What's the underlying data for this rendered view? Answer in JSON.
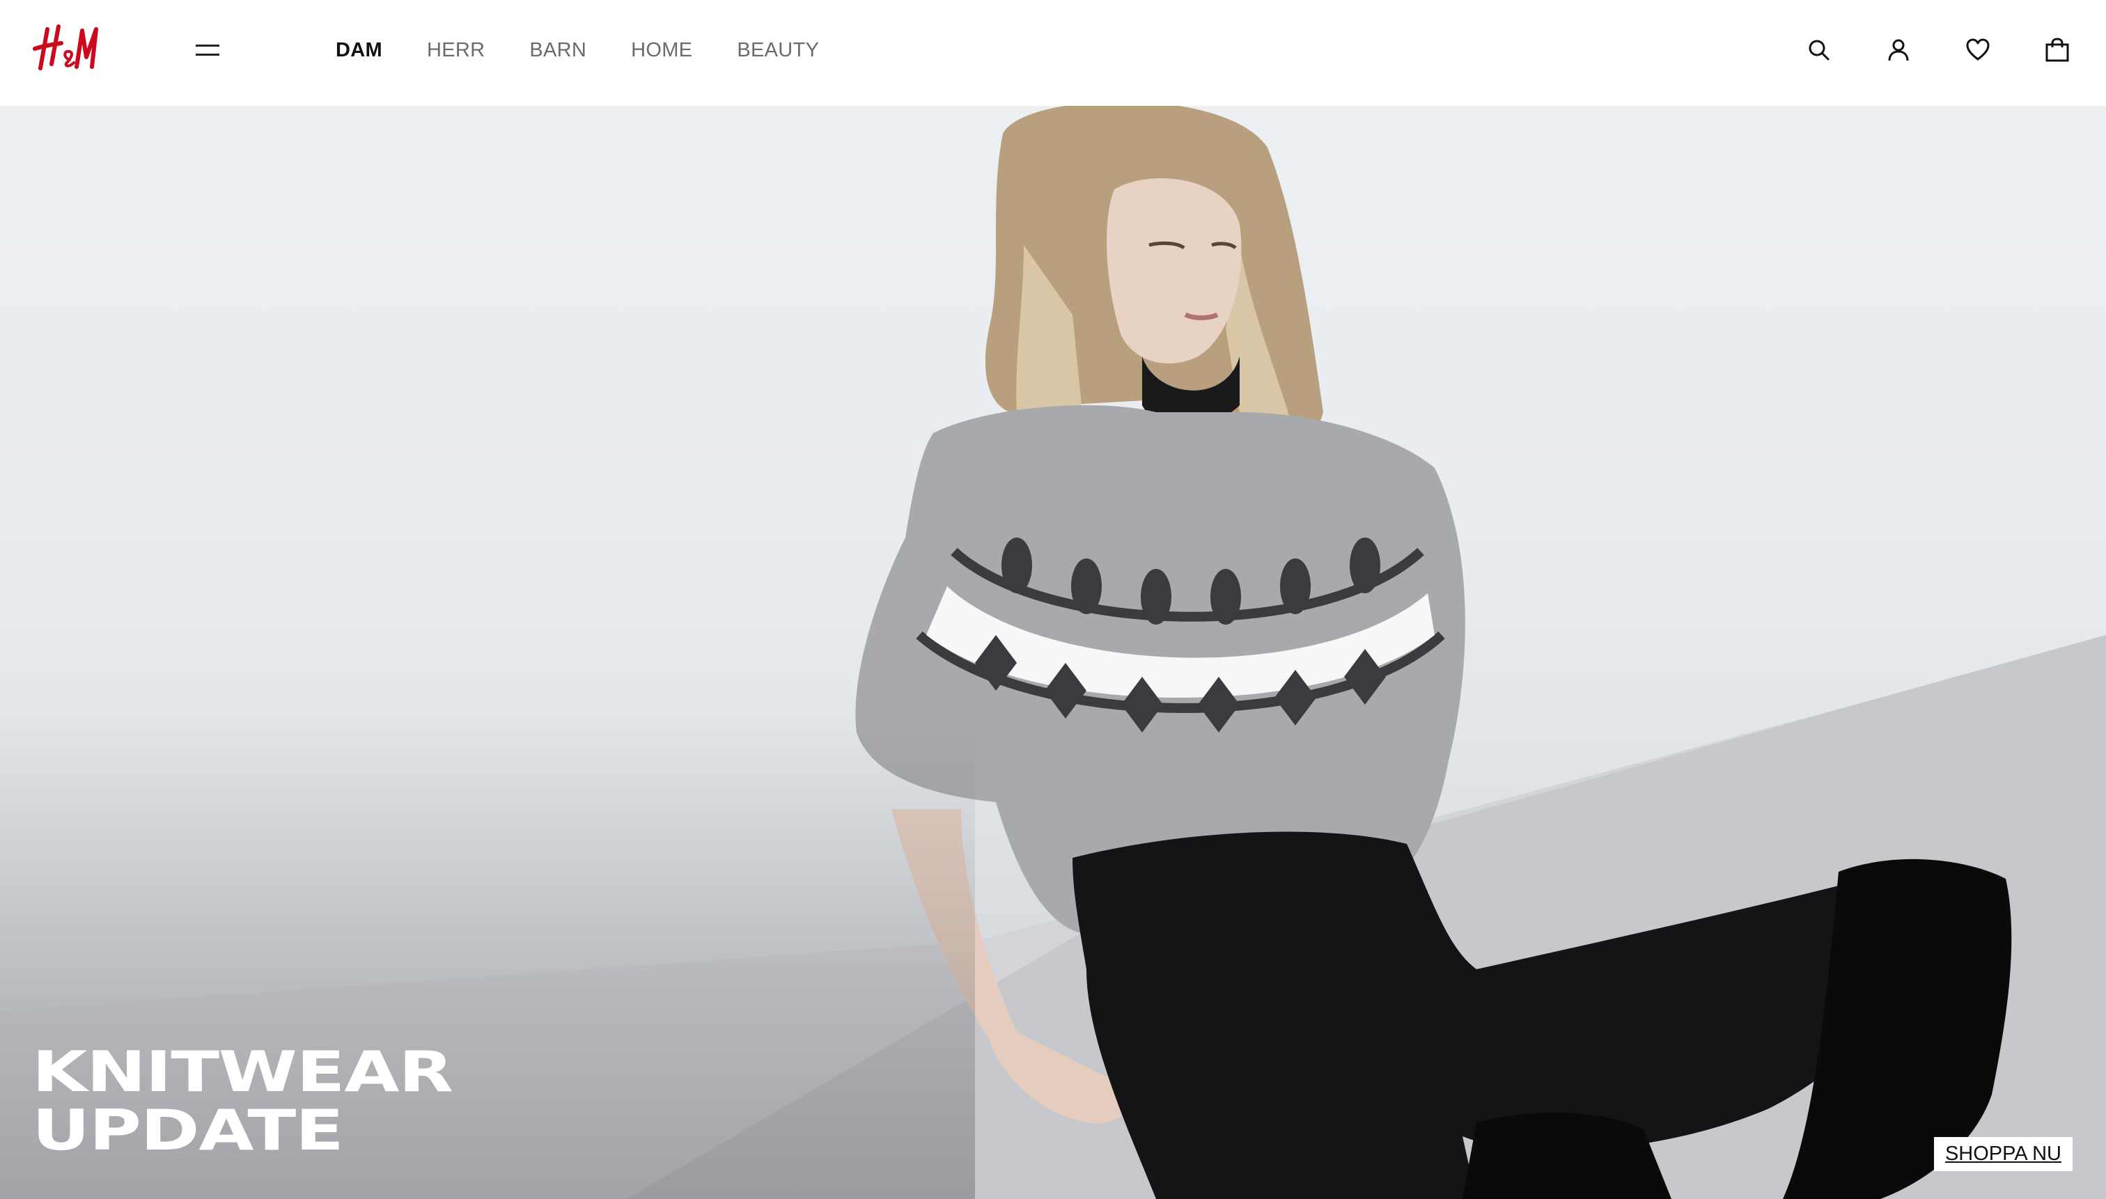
{
  "brand": {
    "logo_text": "H&M",
    "logo_color": "#cc071e"
  },
  "header": {
    "menu_icon": "hamburger-menu-icon",
    "nav": [
      {
        "label": "DAM",
        "active": true
      },
      {
        "label": "HERR",
        "active": false
      },
      {
        "label": "BARN",
        "active": false
      },
      {
        "label": "HOME",
        "active": false
      },
      {
        "label": "BEAUTY",
        "active": false
      }
    ],
    "actions": [
      {
        "icon": "search-icon"
      },
      {
        "icon": "account-icon"
      },
      {
        "icon": "heart-icon"
      },
      {
        "icon": "shopping-bag-icon"
      }
    ]
  },
  "hero": {
    "headline_line1": "KNITWEAR",
    "headline_line2": "UPDATE",
    "cta_label": "SHOPPA NU"
  }
}
